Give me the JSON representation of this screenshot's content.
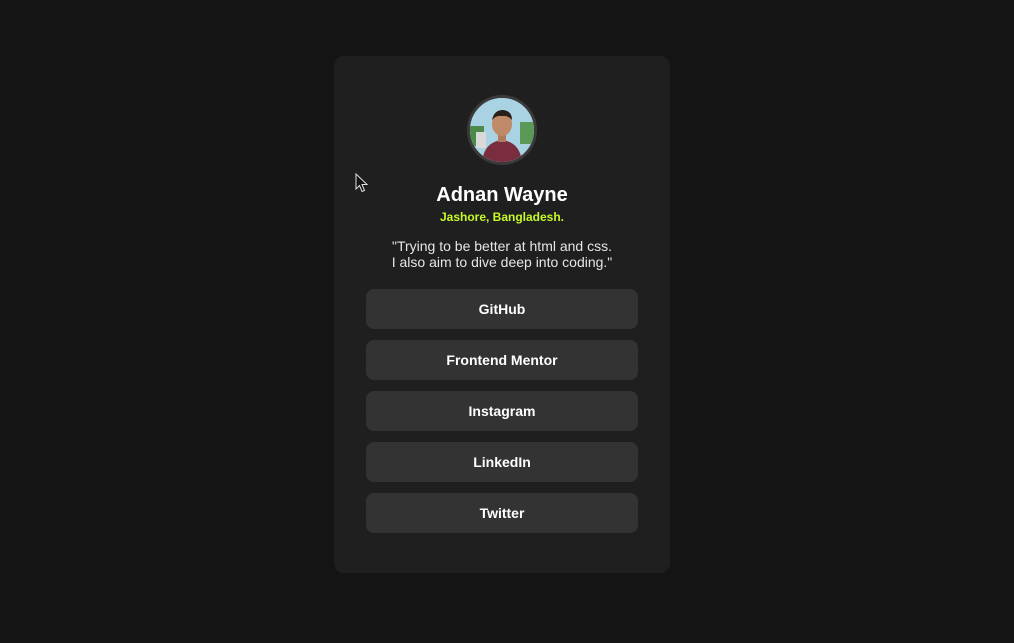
{
  "profile": {
    "avatar_icon": "profile-photo",
    "name": "Adnan Wayne",
    "location": "Jashore, Bangladesh.",
    "bio_line1": "\"Trying to be better at html and css.",
    "bio_line2": "I also aim to dive deep into coding.\""
  },
  "links": [
    {
      "label": "GitHub"
    },
    {
      "label": "Frontend Mentor"
    },
    {
      "label": "Instagram"
    },
    {
      "label": "LinkedIn"
    },
    {
      "label": "Twitter"
    }
  ],
  "colors": {
    "page_bg": "#141414",
    "card_bg": "#1f1f1f",
    "button_bg": "#333333",
    "accent": "#c4f82a",
    "text": "#ffffff"
  }
}
